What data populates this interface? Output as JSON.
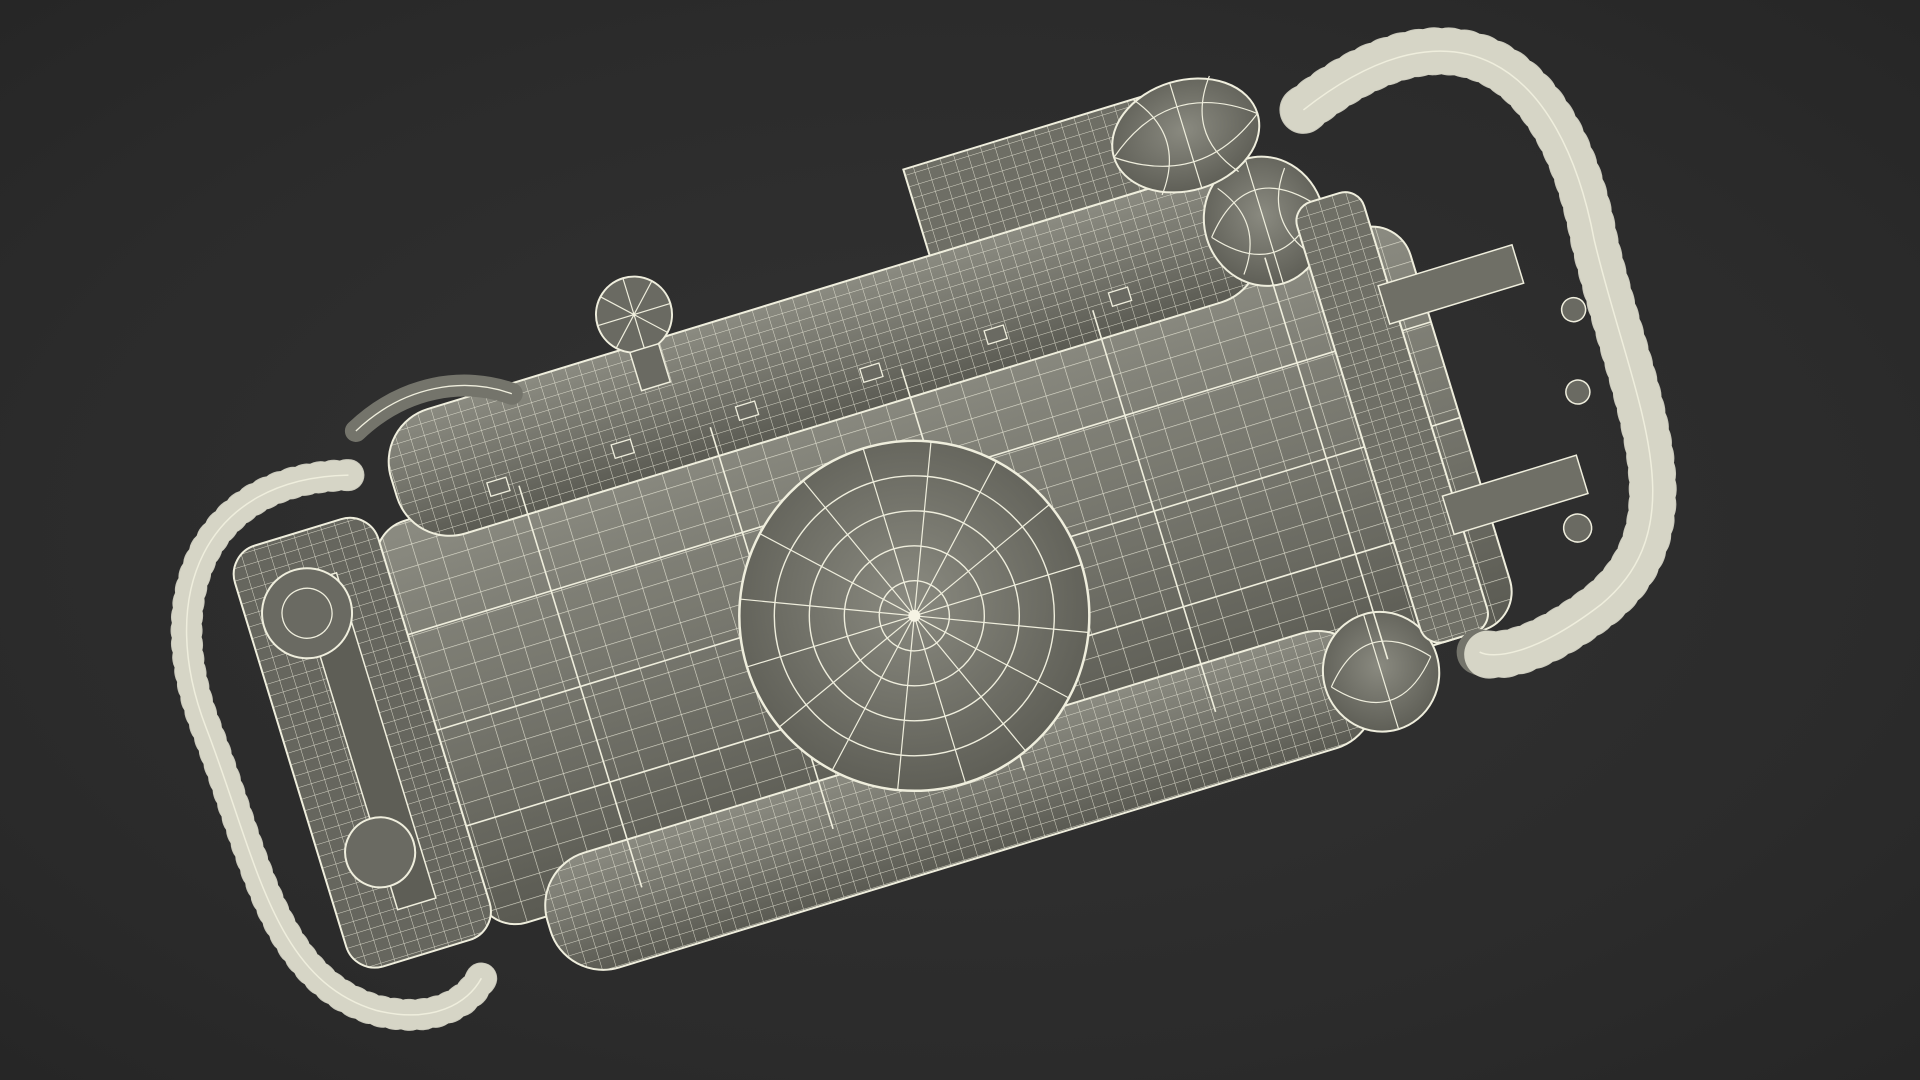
{
  "scene": {
    "background_color": "#2d2d2d",
    "model_fill_color": "#7a7a70",
    "model_shade_color": "#5f5f57",
    "wire_color": "#f2f0dc",
    "description_kind": "wireframe-3d-render"
  }
}
